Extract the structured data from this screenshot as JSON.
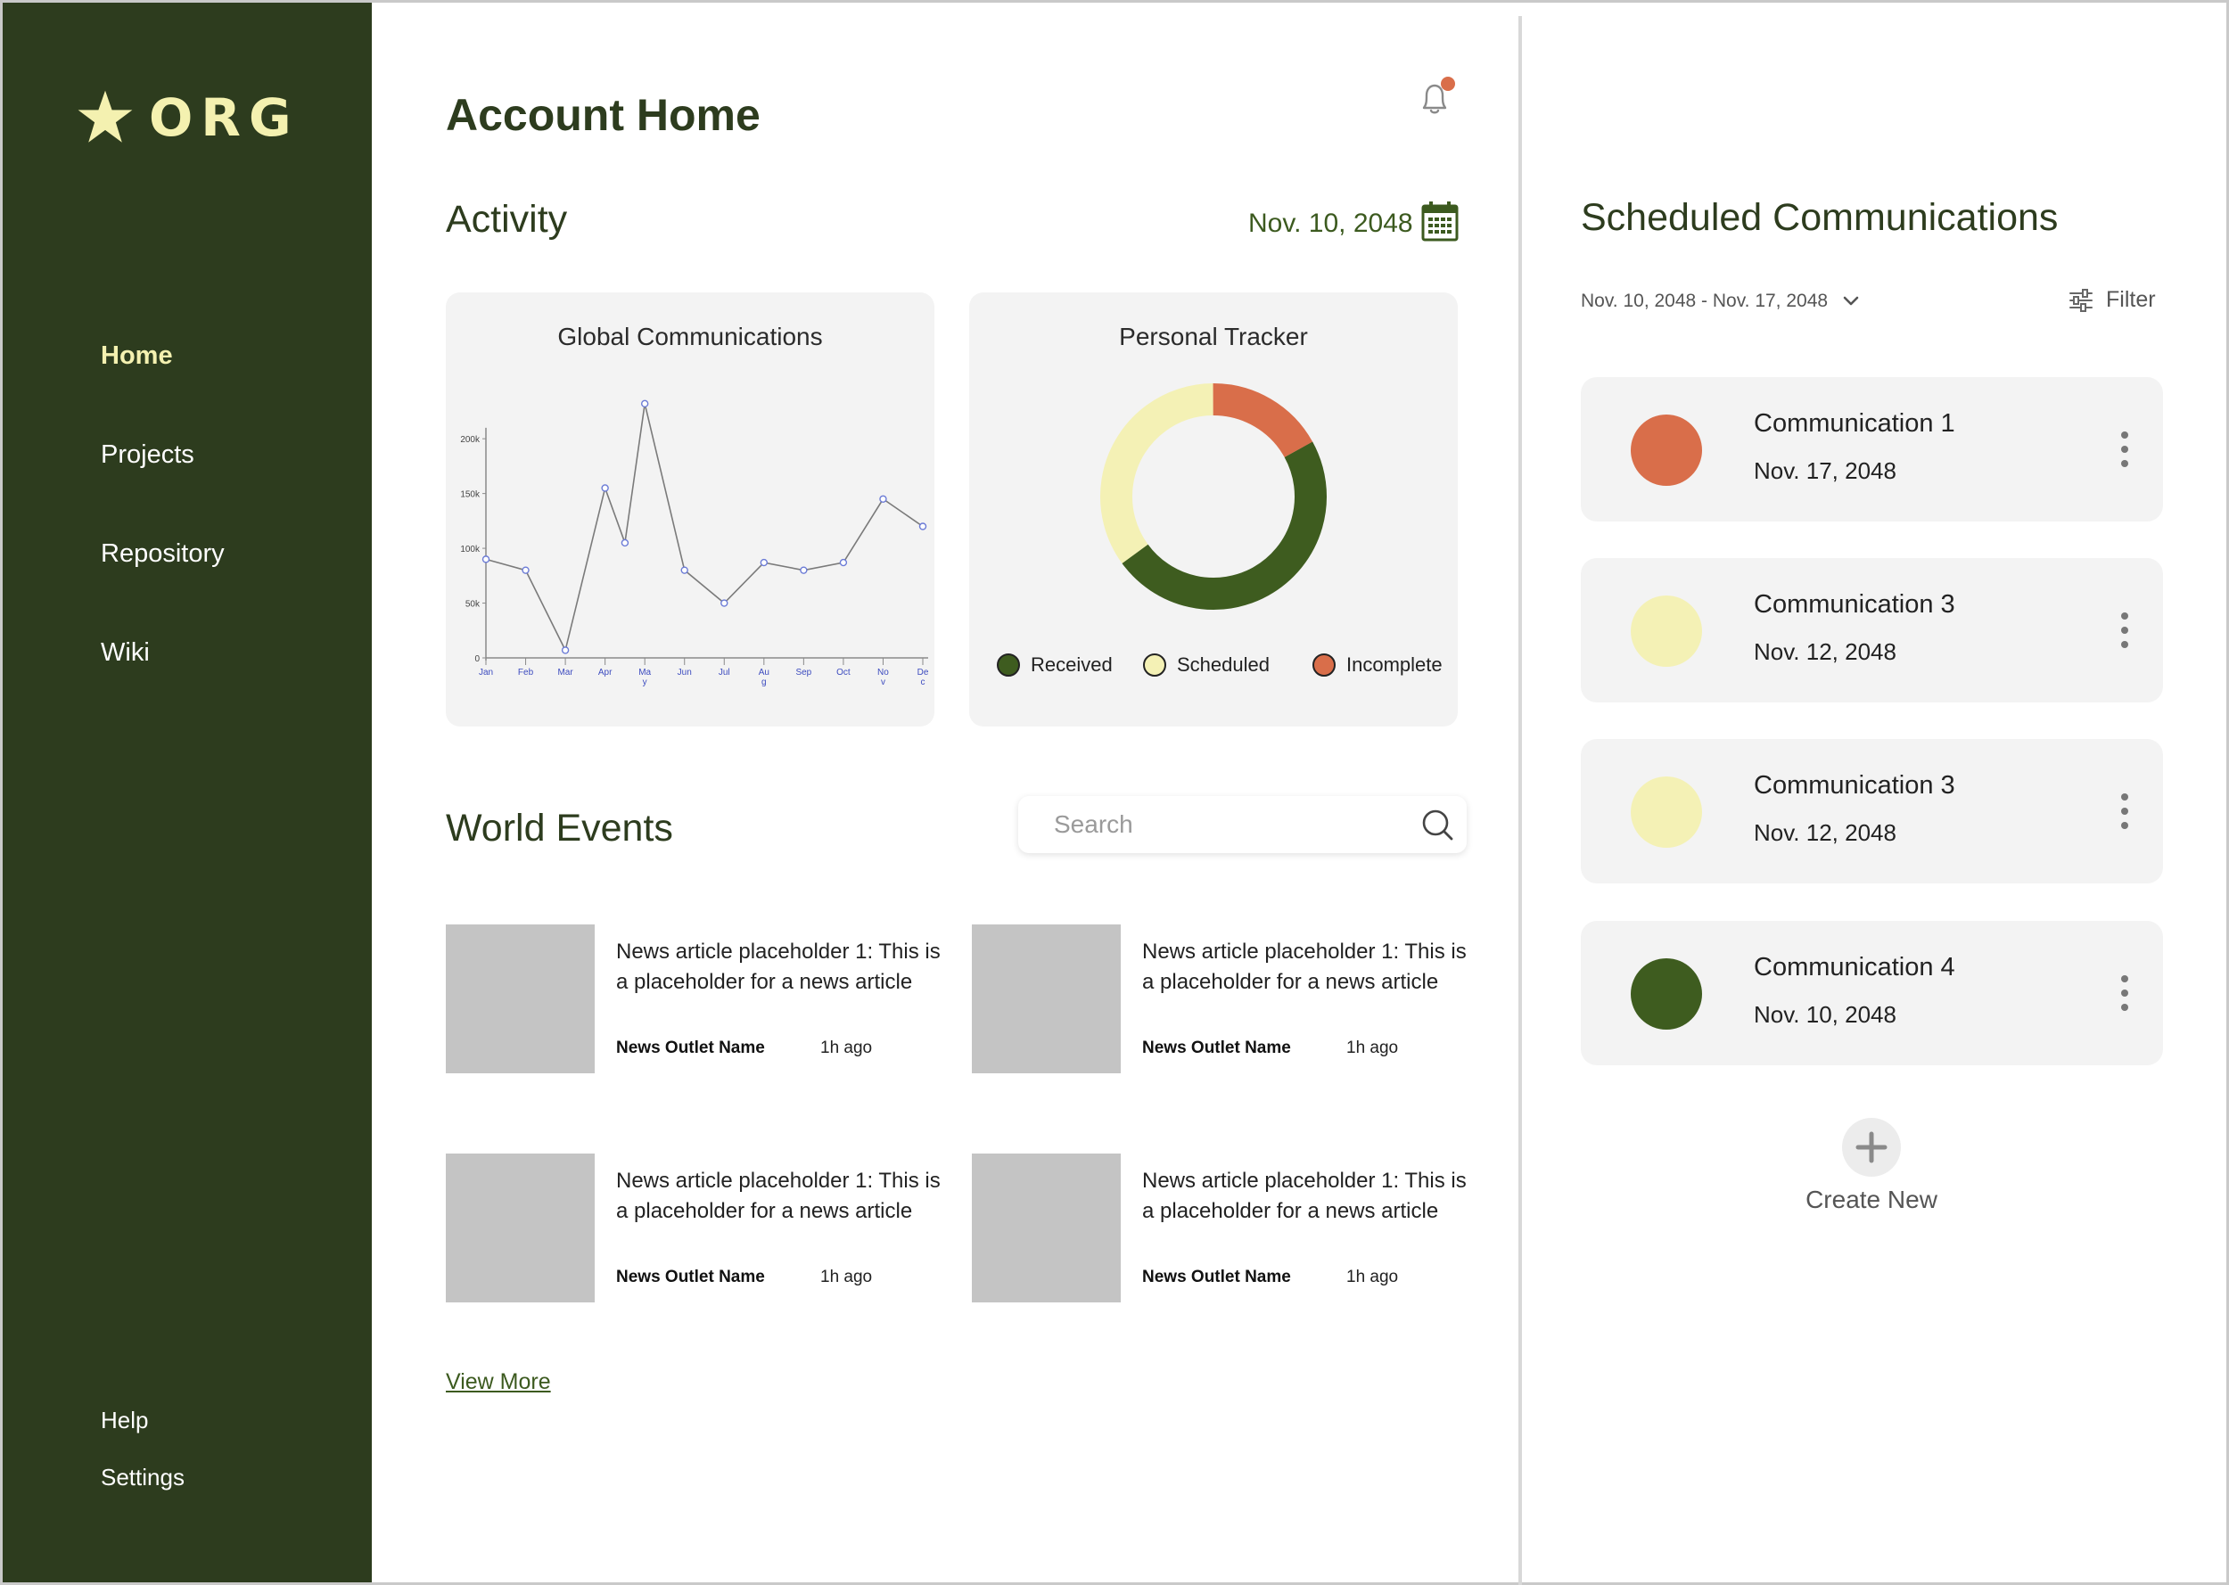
{
  "sidebar": {
    "logo_text": "ORG",
    "nav": [
      {
        "label": "Home",
        "active": true
      },
      {
        "label": "Projects"
      },
      {
        "label": "Repository"
      },
      {
        "label": "Wiki"
      }
    ],
    "help_label": "Help",
    "settings_label": "Settings"
  },
  "header": {
    "title": "Account Home"
  },
  "activity": {
    "title": "Activity",
    "date": "Nov. 10, 2048"
  },
  "global_chart": {
    "title": "Global Communications"
  },
  "personal_tracker": {
    "title": "Personal Tracker"
  },
  "chart_data": [
    {
      "type": "line",
      "title": "Global Communications",
      "categories": [
        "Jan",
        "Feb",
        "Mar",
        "Apr",
        "May",
        "Jun",
        "Jul",
        "Aug",
        "Sep",
        "Oct",
        "Nov",
        "Dec"
      ],
      "x_tick_labels": [
        "Jan",
        "Feb",
        "Mar",
        "Apr",
        "Ma\ny",
        "Jun",
        "Jul",
        "Au\ng",
        "Sep",
        "Oct",
        "No\nv",
        "De\nc"
      ],
      "points": [
        {
          "x": 0.0,
          "y": 90000
        },
        {
          "x": 1.0,
          "y": 80000
        },
        {
          "x": 2.0,
          "y": 7000
        },
        {
          "x": 3.0,
          "y": 155000
        },
        {
          "x": 3.5,
          "y": 105000
        },
        {
          "x": 4.0,
          "y": 232000
        },
        {
          "x": 5.0,
          "y": 80000
        },
        {
          "x": 6.0,
          "y": 50000
        },
        {
          "x": 7.0,
          "y": 87000
        },
        {
          "x": 8.0,
          "y": 80000
        },
        {
          "x": 9.0,
          "y": 87000
        },
        {
          "x": 10.0,
          "y": 145000
        },
        {
          "x": 11.0,
          "y": 120000
        }
      ],
      "y_ticks": [
        "0",
        "50k",
        "100k",
        "150k",
        "200k"
      ],
      "y_tick_values": [
        0,
        50000,
        100000,
        150000,
        200000
      ],
      "ylim": [
        0,
        240000
      ],
      "xlabel": "",
      "ylabel": "",
      "grid": false,
      "colors": {
        "line": "#7a7a7a",
        "marker": "#6b7bd6",
        "tick_label": "#3c4bbf"
      }
    },
    {
      "type": "pie",
      "title": "Personal Tracker",
      "donut": true,
      "labels": [
        "Received",
        "Scheduled",
        "Incomplete"
      ],
      "values": [
        48,
        35,
        17
      ],
      "colors": [
        "#3e5c1f",
        "#f4f1b5",
        "#d96e4a"
      ],
      "legend_position": "bottom"
    }
  ],
  "world_events": {
    "title": "World Events",
    "search_placeholder": "Search",
    "articles": [
      {
        "headline": "News article placeholder 1: This is a placeholder for a news article",
        "outlet": "News Outlet Name",
        "time": "1h ago"
      },
      {
        "headline": "News article placeholder 1: This is a placeholder for a news article",
        "outlet": "News Outlet Name",
        "time": "1h ago"
      },
      {
        "headline": "News article placeholder 1: This is a placeholder for a news article",
        "outlet": "News Outlet Name",
        "time": "1h ago"
      },
      {
        "headline": "News article placeholder 1: This is a placeholder for a news article",
        "outlet": "News Outlet Name",
        "time": "1h ago"
      }
    ],
    "view_more": "View More"
  },
  "scheduled": {
    "title": "Scheduled Communications",
    "range": "Nov. 10, 2048 - Nov. 17, 2048",
    "filter_label": "Filter",
    "items": [
      {
        "name": "Communication 1",
        "date": "Nov. 17, 2048",
        "color": "#d96e4a"
      },
      {
        "name": "Communication 3",
        "date": "Nov. 12, 2048",
        "color": "#f4f1b5"
      },
      {
        "name": "Communication 3",
        "date": "Nov. 12, 2048",
        "color": "#f4f1b5"
      },
      {
        "name": "Communication 4",
        "date": "Nov. 10, 2048",
        "color": "#3e5c1f"
      }
    ],
    "create_label": "Create New"
  },
  "icons": {
    "logo": "star-icon",
    "notifications": "bell-icon",
    "calendar": "calendar-icon",
    "search": "search-icon",
    "date_range": "chevron-down-icon",
    "filter": "sliders-icon",
    "item_menu": "more-vertical-icon",
    "create": "plus-icon"
  },
  "colors": {
    "sidebar_bg": "#2d3c1e",
    "accent_text": "#f4f1b0",
    "brand_green": "#3c5a1f",
    "notification_dot": "#d96e4a",
    "card_bg": "#f3f3f3"
  }
}
